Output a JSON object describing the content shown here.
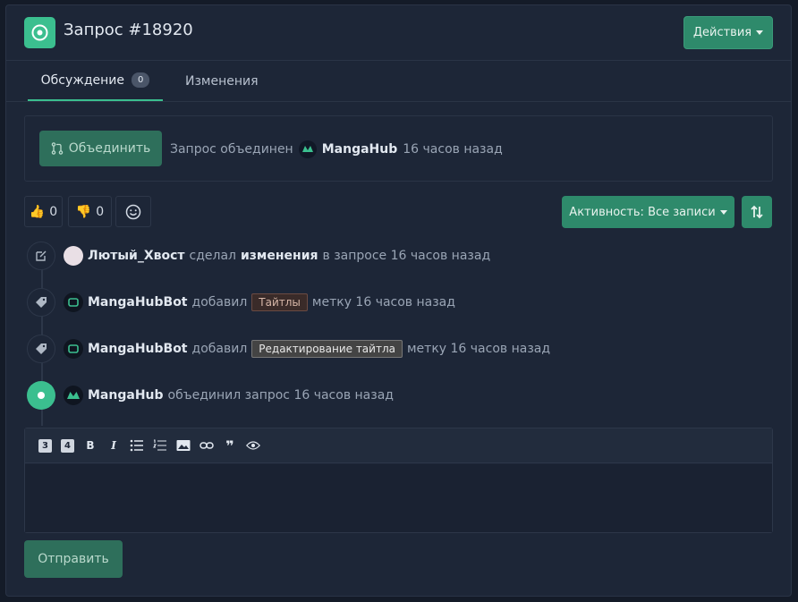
{
  "header": {
    "title": "Запрос #18920",
    "actions_label": "Действия"
  },
  "tabs": [
    {
      "label": "Обсуждение",
      "count": "0"
    },
    {
      "label": "Изменения"
    }
  ],
  "merge": {
    "button_label": "Объединить",
    "text": "Запрос объединен",
    "author": "MangaHub",
    "time": "16 часов назад"
  },
  "reactions": {
    "likes": "0",
    "dislikes": "0"
  },
  "activity": {
    "label": "Активность: Все записи"
  },
  "timeline": [
    {
      "user": "Лютый_Хвост",
      "pre": "сделал",
      "strong": "изменения",
      "post": "в запросе 16 часов назад"
    },
    {
      "user": "MangaHubBot",
      "pre": "добавил",
      "chip": "Тайтлы",
      "post": "метку 16 часов назад"
    },
    {
      "user": "MangaHubBot",
      "pre": "добавил",
      "chip": "Редактирование тайтла",
      "post": "метку 16 часов назад"
    },
    {
      "user": "MangaHub",
      "pre": "объединил запрос 16 часов назад"
    }
  ],
  "editor": {
    "h3": "3",
    "h4": "4",
    "bold": "B",
    "italic": "I",
    "quote": "❞"
  },
  "send_label": "Отправить",
  "colors": {
    "accent": "#3bbf8f",
    "button": "#2e8a6b",
    "background": "#1d2637"
  }
}
